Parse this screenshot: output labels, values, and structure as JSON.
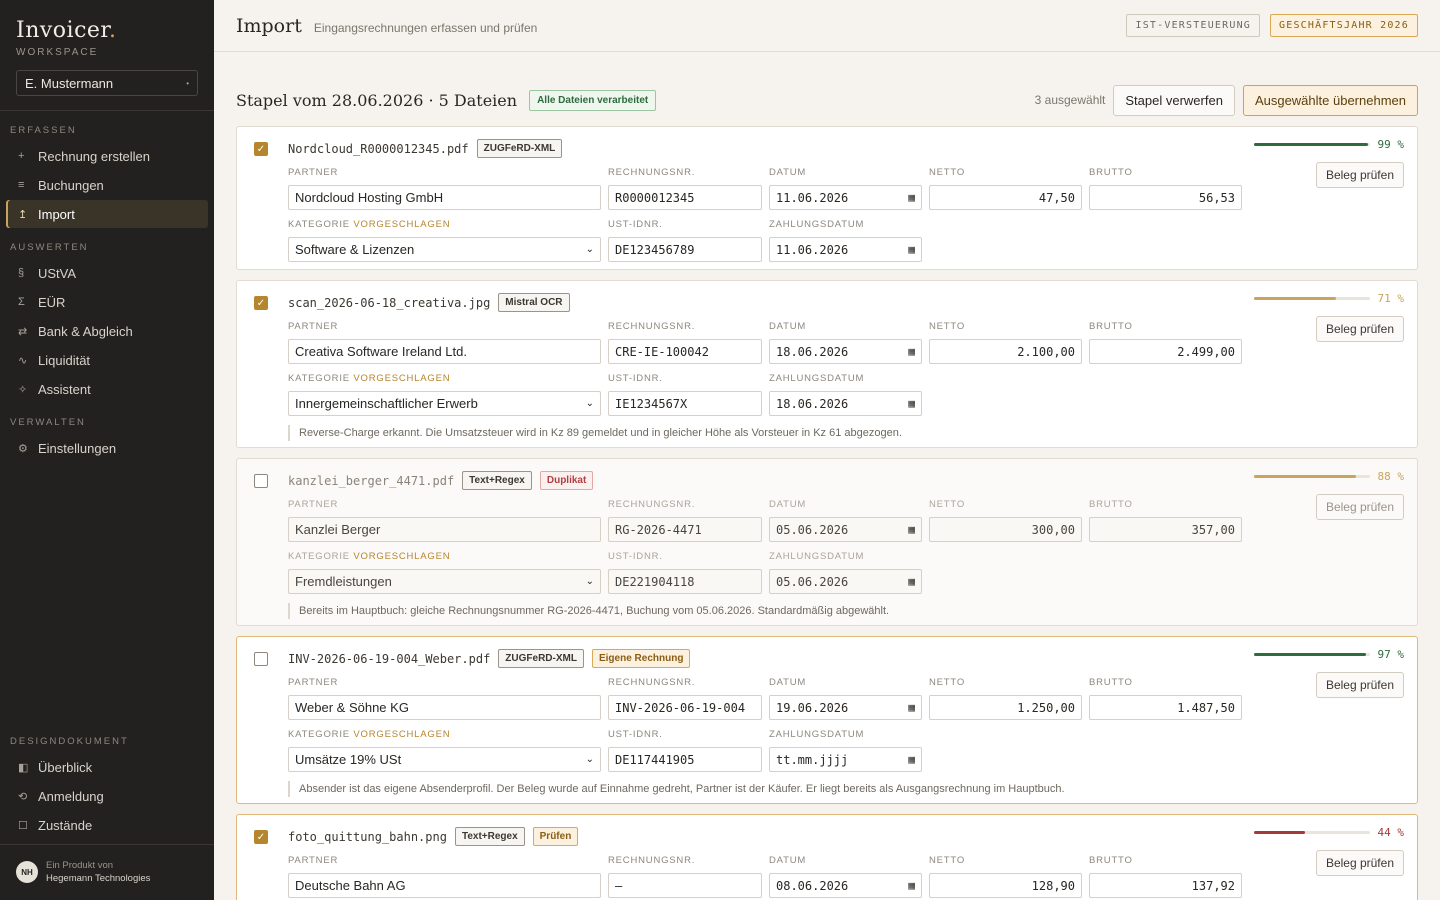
{
  "app": {
    "name": "Invoicer",
    "workspace_label": "WORKSPACE",
    "user": "E. Mustermann"
  },
  "nav": [
    {
      "section": "ERFASSEN",
      "items": [
        {
          "icon": "+",
          "name": "plus-icon",
          "label": "Rechnung erstellen"
        },
        {
          "icon": "≡",
          "name": "list-icon",
          "label": "Buchungen"
        },
        {
          "icon": "↥",
          "name": "upload-icon",
          "label": "Import",
          "active": true
        }
      ]
    },
    {
      "section": "AUSWERTEN",
      "items": [
        {
          "icon": "§",
          "name": "paragraph-icon",
          "label": "UStVA"
        },
        {
          "icon": "Σ",
          "name": "sigma-icon",
          "label": "EÜR"
        },
        {
          "icon": "⇄",
          "name": "transfer-icon",
          "label": "Bank & Abgleich"
        },
        {
          "icon": "∿",
          "name": "trend-icon",
          "label": "Liquidität"
        },
        {
          "icon": "✧",
          "name": "sparkle-icon",
          "label": "Assistent"
        }
      ]
    },
    {
      "section": "VERWALTEN",
      "items": [
        {
          "icon": "⚙",
          "name": "gear-icon",
          "label": "Einstellungen"
        }
      ]
    }
  ],
  "nav_bottom": {
    "section": "DESIGNDOKUMENT",
    "items": [
      {
        "icon": "◧",
        "name": "overview-icon",
        "label": "Überblick"
      },
      {
        "icon": "⟲",
        "name": "login-icon",
        "label": "Anmeldung"
      },
      {
        "icon": "☐",
        "name": "states-icon",
        "label": "Zustände"
      }
    ]
  },
  "footer": {
    "line1": "Ein Produkt von",
    "line2": "Hegemann Technologies",
    "logo": "NH"
  },
  "header": {
    "title": "Import",
    "subtitle": "Eingangsrechnungen erfassen und prüfen",
    "pill1": "IST-VERSTEUERUNG",
    "pill2": "GESCHÄFTSJAHR 2026"
  },
  "batch": {
    "title": "Stapel vom 28.06.2026 · 5 Dateien",
    "status": "Alle Dateien verarbeitet",
    "selected": "3 ausgewählt",
    "discard": "Stapel verwerfen",
    "apply": "Ausgewählte übernehmen"
  },
  "labels": {
    "partner": "PARTNER",
    "rechnungsnr": "RECHNUNGSNR.",
    "datum": "DATUM",
    "netto": "NETTO",
    "brutto": "BRUTTO",
    "kategorie": "KATEGORIE",
    "vorgeschlagen": "VORGESCHLAGEN",
    "ustid": "UST-IDNR.",
    "zahlungsdatum": "ZAHLUNGSDATUM",
    "check": "Beleg prüfen"
  },
  "colors": {
    "accent": "#b5862e",
    "good": "#2f6b3f",
    "warn": "#c9a45c",
    "bad": "#a33a3a"
  },
  "invoices": [
    {
      "checked": true,
      "filename": "Nordcloud_R0000012345.pdf",
      "tags": [
        {
          "text": "ZUGFeRD-XML",
          "style": ""
        }
      ],
      "confidence": 99,
      "confidence_text": "99 %",
      "conf_color": "#2f6b3f",
      "partner": "Nordcloud Hosting GmbH",
      "rechnungsnr": "R0000012345",
      "datum": "11.06.2026",
      "netto": "47,50",
      "brutto": "56,53",
      "kategorie": "Software & Lizenzen",
      "ustid": "DE123456789",
      "zahlungsdatum": "11.06.2026",
      "note": ""
    },
    {
      "checked": true,
      "filename": "scan_2026-06-18_creativa.jpg",
      "tags": [
        {
          "text": "Mistral OCR",
          "style": ""
        }
      ],
      "confidence": 71,
      "confidence_text": "71 %",
      "conf_color": "#c9a45c",
      "partner": "Creativa Software Ireland Ltd.",
      "rechnungsnr": "CRE-IE-100042",
      "datum": "18.06.2026",
      "netto": "2.100,00",
      "brutto": "2.499,00",
      "kategorie": "Innergemeinschaftlicher Erwerb",
      "ustid": "IE1234567X",
      "zahlungsdatum": "18.06.2026",
      "note": "Reverse-Charge erkannt. Die Umsatzsteuer wird in Kz 89 gemeldet und in gleicher Höhe als Vorsteuer in Kz 61 abgezogen."
    },
    {
      "checked": false,
      "muted": true,
      "filename": "kanzlei_berger_4471.pdf",
      "tags": [
        {
          "text": "Text+Regex",
          "style": ""
        },
        {
          "text": "Duplikat",
          "style": "red"
        }
      ],
      "confidence": 88,
      "confidence_text": "88 %",
      "conf_color": "#c9a45c",
      "partner": "Kanzlei Berger",
      "rechnungsnr": "RG-2026-4471",
      "datum": "05.06.2026",
      "netto": "300,00",
      "brutto": "357,00",
      "kategorie": "Fremdleistungen",
      "ustid": "DE221904118",
      "zahlungsdatum": "05.06.2026",
      "note": "Bereits im Hauptbuch: gleiche Rechnungsnummer RG-2026-4471, Buchung vom 05.06.2026. Standardmäßig abgewählt."
    },
    {
      "checked": false,
      "warn": true,
      "filename": "INV-2026-06-19-004_Weber.pdf",
      "tags": [
        {
          "text": "ZUGFeRD-XML",
          "style": ""
        },
        {
          "text": "Eigene Rechnung",
          "style": "gold"
        }
      ],
      "confidence": 97,
      "confidence_text": "97 %",
      "conf_color": "#2f6b3f",
      "partner": "Weber & Söhne KG",
      "rechnungsnr": "INV-2026-06-19-004",
      "datum": "19.06.2026",
      "netto": "1.250,00",
      "brutto": "1.487,50",
      "kategorie": "Umsätze 19% USt",
      "ustid": "DE117441905",
      "zahlungsdatum": "tt.mm.jjjj",
      "note": "Absender ist das eigene Absenderprofil. Der Beleg wurde auf Einnahme gedreht, Partner ist der Käufer. Er liegt bereits als Ausgangsrechnung im Hauptbuch."
    },
    {
      "checked": true,
      "warn": true,
      "filename": "foto_quittung_bahn.png",
      "tags": [
        {
          "text": "Text+Regex",
          "style": ""
        },
        {
          "text": "Prüfen",
          "style": "gold"
        }
      ],
      "confidence": 44,
      "confidence_text": "44 %",
      "conf_color": "#a33a3a",
      "partner": "Deutsche Bahn AG",
      "rechnungsnr": "—",
      "datum": "08.06.2026",
      "netto": "128,90",
      "brutto": "137,92",
      "kategorie": "",
      "ustid": "",
      "zahlungsdatum": "",
      "note": ""
    }
  ]
}
